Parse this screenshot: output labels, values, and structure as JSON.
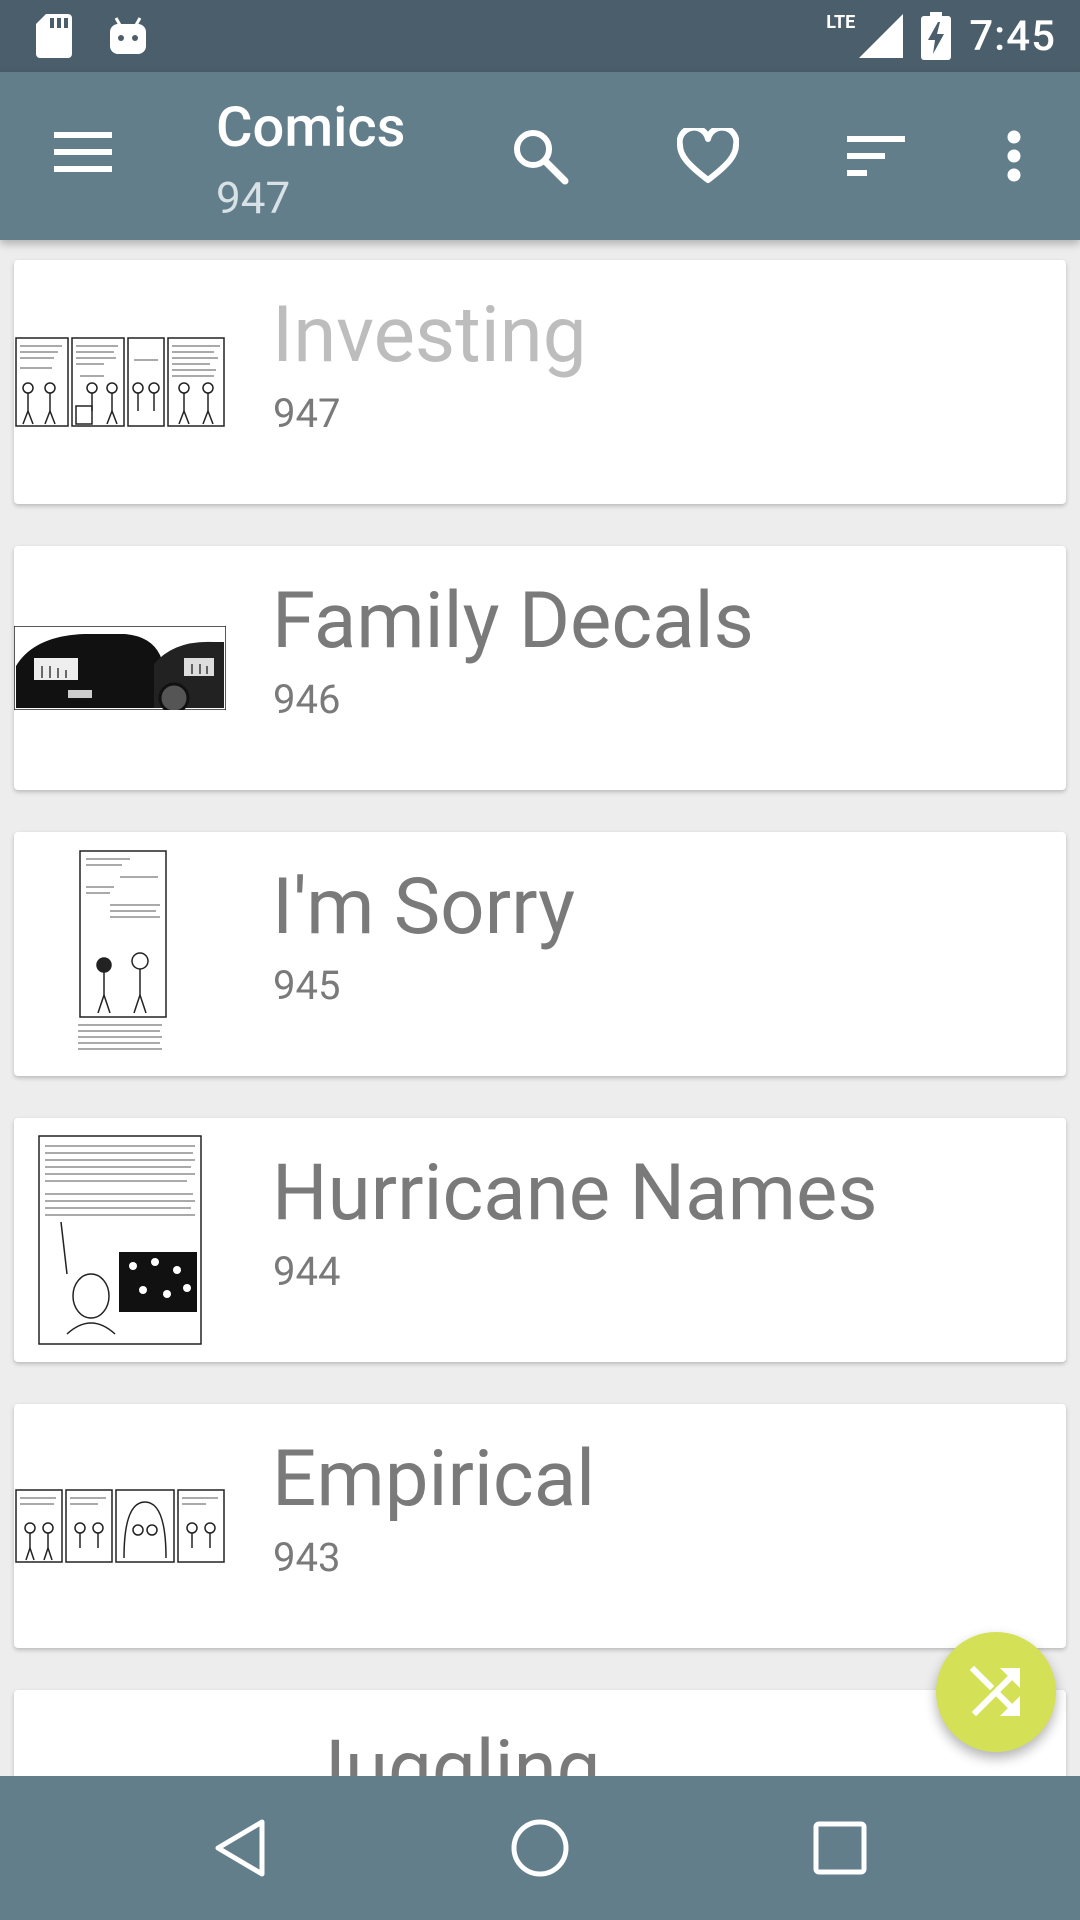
{
  "status_bar": {
    "time": "7:45",
    "network": "LTE",
    "icons": [
      "sd-card-icon",
      "android-icon",
      "signal-icon",
      "battery-charging-icon"
    ]
  },
  "app_bar": {
    "title": "Comics",
    "subtitle": "947",
    "icons": [
      "menu-icon",
      "search-icon",
      "favorite-icon",
      "sort-icon",
      "more-vert-icon"
    ]
  },
  "comics": [
    {
      "title": "Investing",
      "number": "947"
    },
    {
      "title": "Family Decals",
      "number": "946"
    },
    {
      "title": "I'm Sorry",
      "number": "945"
    },
    {
      "title": "Hurricane Names",
      "number": "944"
    },
    {
      "title": "Empirical",
      "number": "943"
    },
    {
      "title": "Juggling",
      "number": ""
    }
  ],
  "fab": {
    "icon": "shuffle-icon"
  },
  "nav_bar": {
    "icons": [
      "back-icon",
      "home-icon",
      "recents-icon"
    ]
  },
  "colors": {
    "status_bar": "#4a5f6b",
    "app_bar": "#637e8b",
    "fab": "#d4e157",
    "text": "#7a7a7a"
  }
}
